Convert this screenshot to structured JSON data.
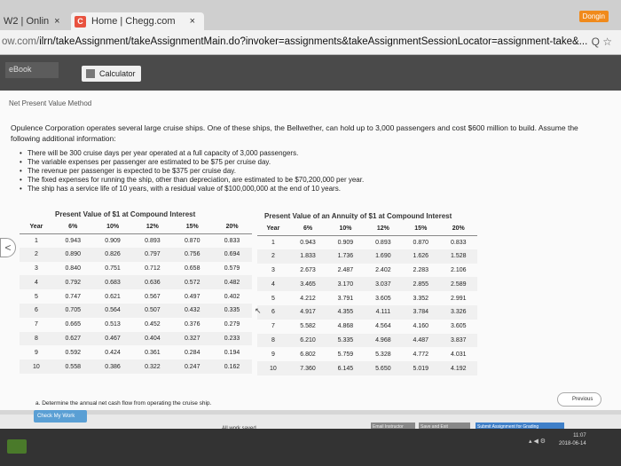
{
  "browser": {
    "tab1_label": "W2 | Onlin",
    "tab2_label": "Home | Chegg.com",
    "tab_close": "×",
    "profile_badge": "Dongin",
    "url_prefix": "ow.com/",
    "url_rest": "ilrn/takeAssignment/takeAssignmentMain.do?invoker=assignments&takeAssignmentSessionLocator=assignment-take&...",
    "addr_icons": "Q ☆"
  },
  "toolbar": {
    "ebook_label": "eBook",
    "calculator_label": "Calculator"
  },
  "content": {
    "section_title": "Net Present Value Method",
    "intro": "Opulence Corporation operates several large cruise ships. One of these ships, the Bellwether, can hold up to 3,000 passengers and cost $600 million to build. Assume the following additional information:",
    "bullets": [
      "There will be 300 cruise days per year operated at a full capacity of 3,000 passengers.",
      "The variable expenses per passenger are estimated to be $75 per cruise day.",
      "The revenue per passenger is expected to be $375 per cruise day.",
      "The fixed expenses for running the ship, other than depreciation, are estimated to be $70,200,000 per year.",
      "The ship has a service life of 10 years, with a residual value of $100,000,000 at the end of 10 years."
    ],
    "pv_table": {
      "title": "Present Value of $1 at Compound Interest",
      "headers": [
        "Year",
        "6%",
        "10%",
        "12%",
        "15%",
        "20%"
      ],
      "rows": [
        [
          "1",
          "0.943",
          "0.909",
          "0.893",
          "0.870",
          "0.833"
        ],
        [
          "2",
          "0.890",
          "0.826",
          "0.797",
          "0.756",
          "0.694"
        ],
        [
          "3",
          "0.840",
          "0.751",
          "0.712",
          "0.658",
          "0.579"
        ],
        [
          "4",
          "0.792",
          "0.683",
          "0.636",
          "0.572",
          "0.482"
        ],
        [
          "5",
          "0.747",
          "0.621",
          "0.567",
          "0.497",
          "0.402"
        ],
        [
          "6",
          "0.705",
          "0.564",
          "0.507",
          "0.432",
          "0.335"
        ],
        [
          "7",
          "0.665",
          "0.513",
          "0.452",
          "0.376",
          "0.279"
        ],
        [
          "8",
          "0.627",
          "0.467",
          "0.404",
          "0.327",
          "0.233"
        ],
        [
          "9",
          "0.592",
          "0.424",
          "0.361",
          "0.284",
          "0.194"
        ],
        [
          "10",
          "0.558",
          "0.386",
          "0.322",
          "0.247",
          "0.162"
        ]
      ]
    },
    "pva_table": {
      "title": "Present Value of an Annuity of $1 at Compound Interest",
      "headers": [
        "Year",
        "6%",
        "10%",
        "12%",
        "15%",
        "20%"
      ],
      "rows": [
        [
          "1",
          "0.943",
          "0.909",
          "0.893",
          "0.870",
          "0.833"
        ],
        [
          "2",
          "1.833",
          "1.736",
          "1.690",
          "1.626",
          "1.528"
        ],
        [
          "3",
          "2.673",
          "2.487",
          "2.402",
          "2.283",
          "2.106"
        ],
        [
          "4",
          "3.465",
          "3.170",
          "3.037",
          "2.855",
          "2.589"
        ],
        [
          "5",
          "4.212",
          "3.791",
          "3.605",
          "3.352",
          "2.991"
        ],
        [
          "6",
          "4.917",
          "4.355",
          "4.111",
          "3.784",
          "3.326"
        ],
        [
          "7",
          "5.582",
          "4.868",
          "4.564",
          "4.160",
          "3.605"
        ],
        [
          "8",
          "6.210",
          "5.335",
          "4.968",
          "4.487",
          "3.837"
        ],
        [
          "9",
          "6.802",
          "5.759",
          "5.328",
          "4.772",
          "4.031"
        ],
        [
          "10",
          "7.360",
          "6.145",
          "5.650",
          "5.019",
          "4.192"
        ]
      ]
    },
    "part_a": "a. Determine the annual net cash flow from operating the cruise ship."
  },
  "footer": {
    "check_label": "Check My Work",
    "previous_label": "Previous",
    "saved_label": "All work saved.",
    "email_label": "Email Instructor",
    "save_exit_label": "Save and Exit",
    "submit_label": "Submit Assignment for Grading"
  },
  "taskbar": {
    "time": "11:07",
    "date": "2018-06-14"
  }
}
